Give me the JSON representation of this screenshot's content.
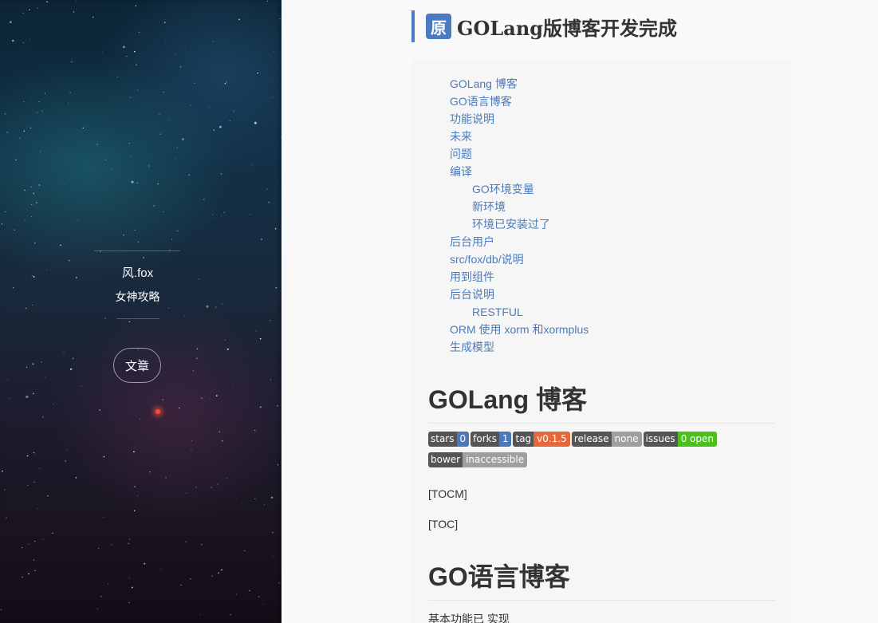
{
  "sidebar": {
    "author": "风.fox",
    "tagline": "女神攻略",
    "nav_button": "文章"
  },
  "post": {
    "badge": "原",
    "title": "GOLang版博客开发完成"
  },
  "toc": [
    {
      "label": "GOLang 博客",
      "level": 1
    },
    {
      "label": "GO语言博客",
      "level": 1
    },
    {
      "label": "功能说明",
      "level": 1
    },
    {
      "label": "未来",
      "level": 1
    },
    {
      "label": "问题",
      "level": 1
    },
    {
      "label": "编译",
      "level": 1
    },
    {
      "label": "GO环境变量",
      "level": 2
    },
    {
      "label": "新环境",
      "level": 2
    },
    {
      "label": "环境已安装过了",
      "level": 2
    },
    {
      "label": "后台用户",
      "level": 1
    },
    {
      "label": "src/fox/db/说明",
      "level": 1
    },
    {
      "label": "用到组件",
      "level": 1
    },
    {
      "label": "后台说明",
      "level": 1
    },
    {
      "label": "RESTFUL",
      "level": 2
    },
    {
      "label": "ORM 使用 xorm 和xormplus",
      "level": 1
    },
    {
      "label": "生成模型",
      "level": 1
    }
  ],
  "section1": {
    "heading": "GOLang 博客"
  },
  "badges": [
    {
      "key": "stars",
      "value": "0",
      "color": "#4c78b5"
    },
    {
      "key": "forks",
      "value": "1",
      "color": "#4c78b5"
    },
    {
      "key": "tag",
      "value": "v0.1.5",
      "color": "#e8673a"
    },
    {
      "key": "release",
      "value": "none",
      "color": "#9f9f9f"
    },
    {
      "key": "issues",
      "value": "0 open",
      "color": "#4bbf1c"
    },
    {
      "key": "bower",
      "value": "inaccessible",
      "color": "#9f9f9f"
    }
  ],
  "paragraphs": {
    "tocm": "[TOCM]",
    "toc": "[TOC]"
  },
  "section2": {
    "heading": "GO语言博客",
    "first_line": "基本功能已 实现"
  }
}
